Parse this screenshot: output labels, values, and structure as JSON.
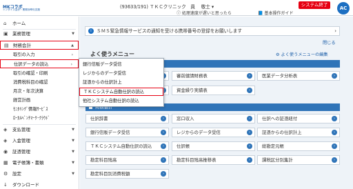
{
  "header": {
    "logo_brand": "MKコラボ",
    "logo_tagline": "インタイス会計・業務効率化支援",
    "user_info": "(93633/191) ＴＫＣクリニック　員 　敬士 ▾",
    "system_link": "ⓘ 処理速度が遅いと思ったら",
    "guide_link": "📘 基本操作ガイド",
    "exit_button": "システム終了",
    "avatar_label": "AC"
  },
  "sidebar": {
    "items": [
      {
        "label": "ホーム",
        "icon": "home-icon"
      },
      {
        "label": "業務管理",
        "icon": "briefcase-icon"
      },
      {
        "label": "財務会計",
        "icon": "ledger-icon"
      },
      {
        "label": "支払管理",
        "icon": "payment-icon"
      },
      {
        "label": "入金管理",
        "icon": "deposit-icon"
      },
      {
        "label": "証憑管理",
        "icon": "receipt-icon"
      },
      {
        "label": "電子帳簿・書類",
        "icon": "document-icon"
      },
      {
        "label": "設定",
        "icon": "gear-icon"
      },
      {
        "label": "ダウンロード",
        "icon": "download-icon"
      }
    ],
    "sub_items": [
      "取引の入力",
      "仕訳データの読込",
      "取引の確認・印刷",
      "消費税科目の確認",
      "月次・年次決算",
      "経営計画",
      "ﾓﾆﾀﾘﾝｸﾞ情報ｻｰﾋﾞｽ",
      "ﾛｰｶﾙﾍﾞﾝﾁﾏｰｸ･ｸﾗｳﾄﾞ"
    ]
  },
  "main": {
    "notice": "ＳＭＳ緊急情報サービスの通知を受ける携帯番号の登録をお願いします",
    "close_link": "閉じる",
    "menu_title": "よく使うメニュー",
    "menu_edit": "よく使うメニューの編集",
    "section1_title": "",
    "section2_title": "財務会計",
    "row1": [
      "",
      "審前健請財務表",
      "医業データ分析表"
    ],
    "row2": [
      "",
      "資金繰り実績表"
    ],
    "cards": [
      "仕訳辞書",
      "窓口収入",
      "仕訳への証憑紐付",
      "銀行信販データ受信",
      "レジからのデータ受信",
      "証憑からの仕訳計上",
      "ＴＫＣシステム自動仕訳の読込",
      "仕訳帳",
      "総勘定元帳",
      "勘定科目残高",
      "勘定科目残高推移表",
      "課税区分別集計",
      "勘定科目別消費税額"
    ]
  },
  "dropdown": {
    "items": [
      "銀行信販データ受信",
      "レジからのデータ受信",
      "証憑からの仕訳計上",
      "ＴＫＣシステム自動仕訳の読込",
      "他社システム自動仕訳の読込"
    ],
    "selected_index": 3
  },
  "colors": {
    "accent": "#2f74b8",
    "highlight": "#e60012",
    "exit": "#e60012"
  }
}
